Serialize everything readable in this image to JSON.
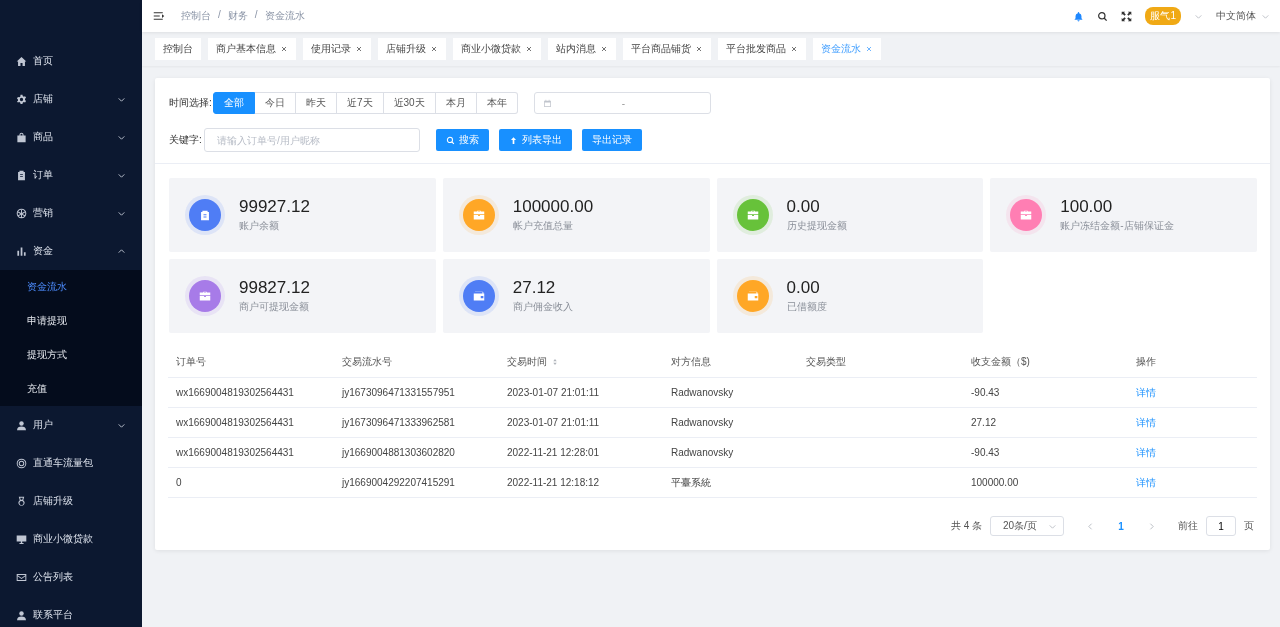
{
  "sidebar": {
    "items": [
      {
        "label": "首页",
        "kind": "link",
        "selected": false
      },
      {
        "label": "店铺",
        "kind": "menu",
        "expanded": false,
        "selected": false
      },
      {
        "label": "商品",
        "kind": "menu",
        "expanded": false,
        "selected": false
      },
      {
        "label": "订单",
        "kind": "menu",
        "expanded": false,
        "selected": false
      },
      {
        "label": "营销",
        "kind": "menu",
        "expanded": false,
        "selected": false
      },
      {
        "label": "资金",
        "kind": "menu",
        "expanded": true,
        "selected": false,
        "children": [
          {
            "label": "资金流水",
            "selected": true
          },
          {
            "label": "申请提现",
            "selected": false
          },
          {
            "label": "提现方式",
            "selected": false
          },
          {
            "label": "充值",
            "selected": false
          }
        ]
      },
      {
        "label": "用户",
        "kind": "menu",
        "expanded": false,
        "selected": false
      },
      {
        "label": "直通车流量包",
        "kind": "link",
        "selected": false
      },
      {
        "label": "店铺升级",
        "kind": "link",
        "selected": false
      },
      {
        "label": "商业小微贷款",
        "kind": "link",
        "selected": false
      },
      {
        "label": "公告列表",
        "kind": "link",
        "selected": false
      },
      {
        "label": "联系平台",
        "kind": "link",
        "selected": false
      }
    ]
  },
  "header": {
    "breadcrumb": [
      "控制台",
      "财务",
      "资金流水"
    ],
    "separator": "/",
    "user_badge": "服气1",
    "language": "中文简体"
  },
  "tabs": [
    {
      "label": "控制台",
      "closable": false,
      "selected": false
    },
    {
      "label": "商户基本信息",
      "closable": true,
      "selected": false
    },
    {
      "label": "使用记录",
      "closable": true,
      "selected": false
    },
    {
      "label": "店铺升级",
      "closable": true,
      "selected": false
    },
    {
      "label": "商业小微贷款",
      "closable": true,
      "selected": false
    },
    {
      "label": "站内消息",
      "closable": true,
      "selected": false
    },
    {
      "label": "平台商品铺货",
      "closable": true,
      "selected": false
    },
    {
      "label": "平台批发商品",
      "closable": true,
      "selected": false
    },
    {
      "label": "资金流水",
      "closable": true,
      "selected": true
    }
  ],
  "filters": {
    "time_label": "时间选择:",
    "time_options": [
      {
        "label": "全部",
        "selected": true
      },
      {
        "label": "今日",
        "selected": false
      },
      {
        "label": "昨天",
        "selected": false
      },
      {
        "label": "近7天",
        "selected": false
      },
      {
        "label": "近30天",
        "selected": false
      },
      {
        "label": "本月",
        "selected": false
      },
      {
        "label": "本年",
        "selected": false
      }
    ],
    "date_range_separator": "-",
    "keyword_label": "关键字:",
    "keyword_placeholder": "请输入订单号/用户昵称",
    "buttons": [
      {
        "label": "搜索",
        "kind": "search"
      },
      {
        "label": "列表导出",
        "kind": "export"
      },
      {
        "label": "导出记录",
        "kind": "plain"
      }
    ]
  },
  "stats": [
    {
      "value": "99927.12",
      "label": "账户余额",
      "color": "#4f7df5"
    },
    {
      "value": "100000.00",
      "label": "帐户充值总量",
      "color": "#ffa726"
    },
    {
      "value": "0.00",
      "label": "历史提现金额",
      "color": "#67c23a"
    },
    {
      "value": "100.00",
      "label": "账户冻结金额-店铺保证金",
      "color": "#ff7eb3"
    },
    {
      "value": "99827.12",
      "label": "商户可提现金额",
      "color": "#a77be8"
    },
    {
      "value": "27.12",
      "label": "商户佣金收入",
      "color": "#4f7df5"
    },
    {
      "value": "0.00",
      "label": "已借额度",
      "color": "#ffa726"
    }
  ],
  "table": {
    "columns": [
      {
        "label": "订单号",
        "sortable": false
      },
      {
        "label": "交易流水号",
        "sortable": false
      },
      {
        "label": "交易时间",
        "sortable": true
      },
      {
        "label": "对方信息",
        "sortable": false
      },
      {
        "label": "交易类型",
        "sortable": false
      },
      {
        "label": "收支金额（$)",
        "sortable": false
      },
      {
        "label": "操作",
        "sortable": false
      }
    ],
    "rows": [
      {
        "cells": [
          "wx1669004819302564431",
          "jy1673096471331557951",
          "2023-01-07 21:01:11",
          "Radwanovsky",
          "",
          "-90.43"
        ],
        "action": "详情"
      },
      {
        "cells": [
          "wx1669004819302564431",
          "jy1673096471333962581",
          "2023-01-07 21:01:11",
          "Radwanovsky",
          "",
          "27.12"
        ],
        "action": "详情"
      },
      {
        "cells": [
          "wx1669004819302564431",
          "jy1669004881303602820",
          "2022-11-21 12:28:01",
          "Radwanovsky",
          "",
          "-90.43"
        ],
        "action": "详情"
      },
      {
        "cells": [
          "0",
          "jy1669004292207415291",
          "2022-11-21 12:18:12",
          "平臺系統",
          "",
          "100000.00"
        ],
        "action": "详情"
      }
    ]
  },
  "pagination": {
    "total": "共 4 条",
    "page_size": "20条/页",
    "pages": [
      {
        "label": "1",
        "selected": true
      }
    ],
    "goto_label": "前往",
    "goto_value": "1",
    "goto_suffix": "页"
  }
}
